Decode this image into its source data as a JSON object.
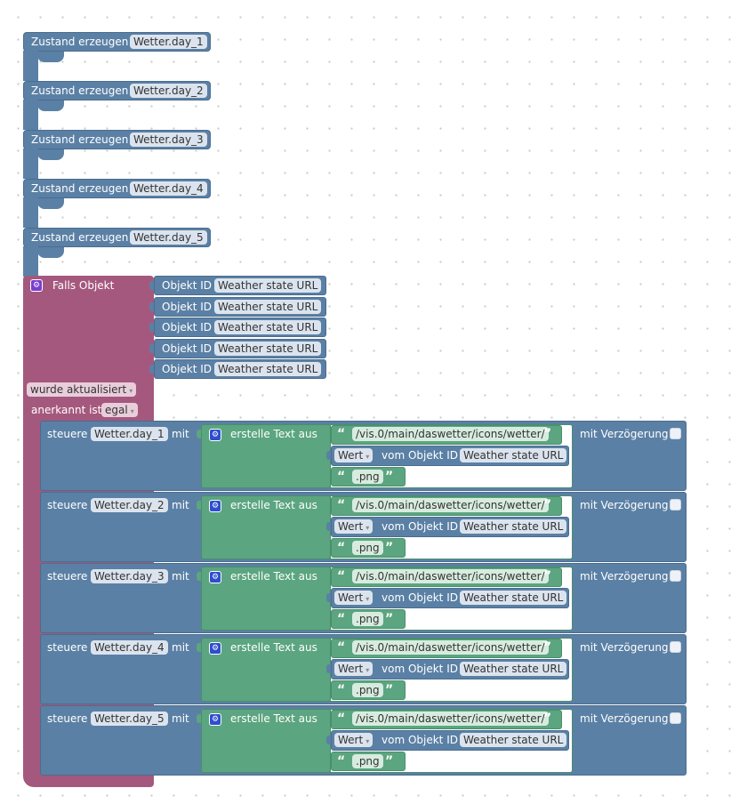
{
  "create_blocks": [
    {
      "label": "Zustand erzeugen",
      "state": "Wetter.day_1"
    },
    {
      "label": "Zustand erzeugen",
      "state": "Wetter.day_2"
    },
    {
      "label": "Zustand erzeugen",
      "state": "Wetter.day_3"
    },
    {
      "label": "Zustand erzeugen",
      "state": "Wetter.day_4"
    },
    {
      "label": "Zustand erzeugen",
      "state": "Wetter.day_5"
    }
  ],
  "trigger": {
    "label": "Falls Objekt",
    "object_label": "Objekt ID",
    "objects": [
      "Weather state URL",
      "Weather state URL",
      "Weather state URL",
      "Weather state URL",
      "Weather state URL"
    ],
    "condition": "wurde aktualisiert",
    "ack_label": "anerkannt ist",
    "ack_value": "egal"
  },
  "control_blocks": [
    {
      "label": "steuere",
      "state": "Wetter.day_1",
      "with": "mit",
      "text_label": "erstelle Text aus",
      "path": "/vis.0/main/daswetter/icons/wetter/",
      "value_dropdown": "Wert",
      "from_object": "vom Objekt ID",
      "object": "Weather state URL",
      "suffix": ".png",
      "delay_label": "mit Verzögerung"
    },
    {
      "label": "steuere",
      "state": "Wetter.day_2",
      "with": "mit",
      "text_label": "erstelle Text aus",
      "path": "/vis.0/main/daswetter/icons/wetter/",
      "value_dropdown": "Wert",
      "from_object": "vom Objekt ID",
      "object": "Weather state URL",
      "suffix": ".png",
      "delay_label": "mit Verzögerung"
    },
    {
      "label": "steuere",
      "state": "Wetter.day_3",
      "with": "mit",
      "text_label": "erstelle Text aus",
      "path": "/vis.0/main/daswetter/icons/wetter/",
      "value_dropdown": "Wert",
      "from_object": "vom Objekt ID",
      "object": "Weather state URL",
      "suffix": ".png",
      "delay_label": "mit Verzögerung"
    },
    {
      "label": "steuere",
      "state": "Wetter.day_4",
      "with": "mit",
      "text_label": "erstelle Text aus",
      "path": "/vis.0/main/daswetter/icons/wetter/",
      "value_dropdown": "Wert",
      "from_object": "vom Objekt ID",
      "object": "Weather state URL",
      "suffix": ".png",
      "delay_label": "mit Verzögerung"
    },
    {
      "label": "steuere",
      "state": "Wetter.day_5",
      "with": "mit",
      "text_label": "erstelle Text aus",
      "path": "/vis.0/main/daswetter/icons/wetter/",
      "value_dropdown": "Wert",
      "from_object": "vom Objekt ID",
      "object": "Weather state URL",
      "suffix": ".png",
      "delay_label": "mit Verzögerung"
    }
  ],
  "colors": {
    "logic_blue": "#5b80a5",
    "trigger_pink": "#a5587d",
    "text_green": "#5ba580"
  },
  "icons": {
    "block_settings": "gear-icon",
    "dropdown": "chevron-down-icon",
    "quote_open": "“",
    "quote_close": "”"
  }
}
